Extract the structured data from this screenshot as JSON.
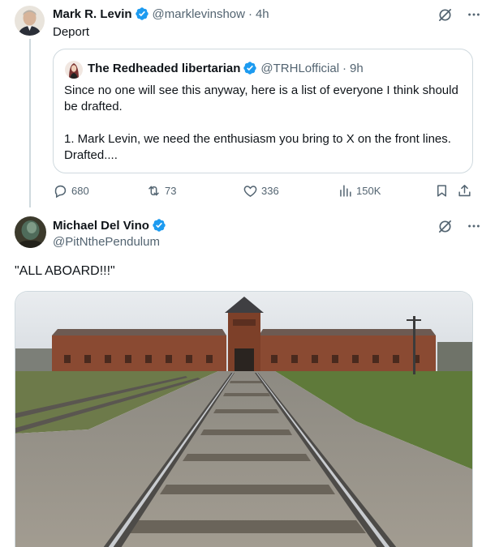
{
  "post1": {
    "author_name": "Mark R. Levin",
    "handle": "@marklevinshow",
    "separator": "·",
    "time": "4h",
    "text": "Deport",
    "quote": {
      "author_name": "The Redheaded libertarian",
      "handle": "@TRHLofficial",
      "separator": "·",
      "time": "9h",
      "paragraph1": "Since no one will see this anyway, here is a list of everyone I think should be drafted.",
      "paragraph2": "1. Mark Levin, we need the enthusiasm you bring to X on the front lines. Drafted...."
    },
    "actions": {
      "replies": "680",
      "reposts": "73",
      "likes": "336",
      "views": "150K"
    }
  },
  "post2": {
    "author_name": "Michael Del Vino",
    "handle": "@PitNthePendulum",
    "text": "\"ALL ABOARD!!!\""
  },
  "colors": {
    "text": "#0f1419",
    "secondary": "#536471",
    "border": "#cfd9de",
    "verified": "#1d9bf0"
  },
  "icons": {
    "verified": "verified-badge-icon",
    "grok": "grok-icon",
    "more": "more-dots-icon",
    "reply": "reply-icon",
    "repost": "repost-icon",
    "like": "heart-icon",
    "views": "views-icon",
    "bookmark": "bookmark-icon",
    "share": "share-icon"
  }
}
